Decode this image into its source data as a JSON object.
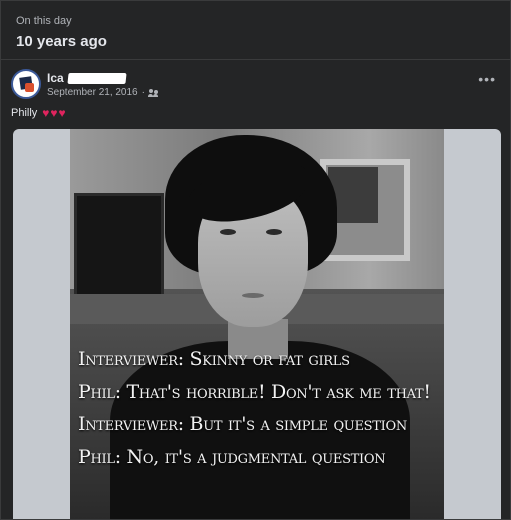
{
  "memory": {
    "subtitle": "On this day",
    "title": "10 years ago"
  },
  "post": {
    "author": "Ica",
    "date": "September 21, 2016",
    "privacy_icon": "friends-icon",
    "more_label": "•••",
    "caption": "Philly",
    "hearts": "♥♥♥",
    "heart_color": "#e0245e"
  },
  "image": {
    "lines": [
      "Interviewer: Skinny or fat girls",
      "Phil: That's horrible! Don't ask me that!",
      "Interviewer: But it's a simple question",
      "Phil: No, it's a judgmental question"
    ]
  }
}
